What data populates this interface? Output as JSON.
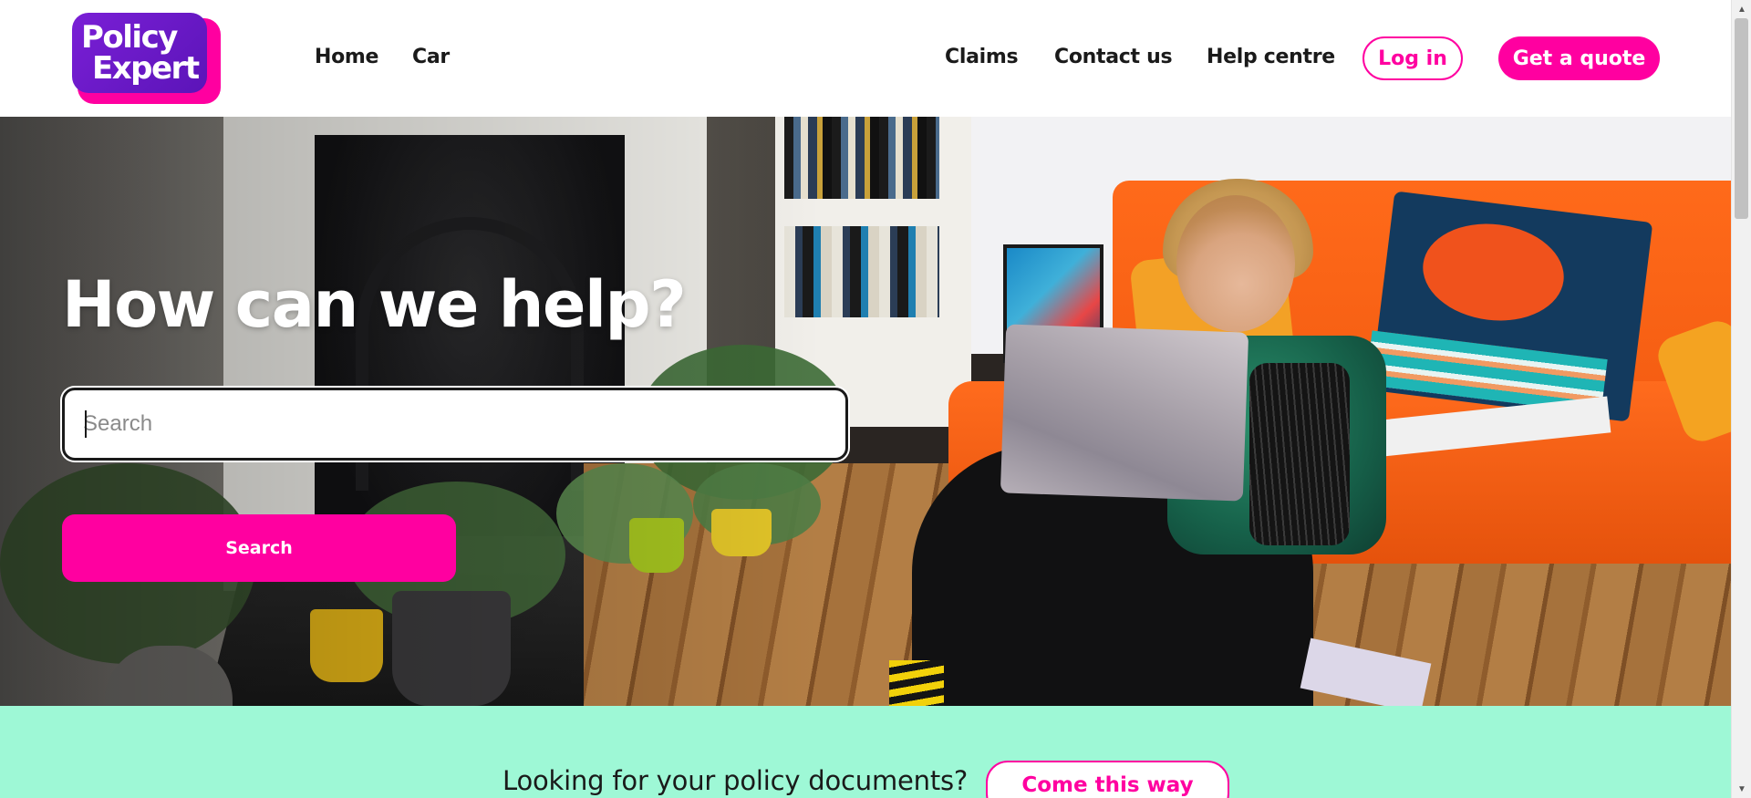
{
  "header": {
    "logo": {
      "line1": "Policy",
      "line2": "Expert"
    },
    "nav_left": [
      {
        "label": "Home"
      },
      {
        "label": "Car"
      }
    ],
    "nav_right": [
      {
        "label": "Claims"
      },
      {
        "label": "Contact us"
      },
      {
        "label": "Help centre"
      }
    ],
    "login_label": "Log in",
    "quote_label": "Get a quote"
  },
  "hero": {
    "title": "How can we help?",
    "search": {
      "placeholder": "Search",
      "value": ""
    },
    "search_button_label": "Search"
  },
  "banner": {
    "text": "Looking for your policy documents?",
    "button_label": "Come this way"
  },
  "colors": {
    "brand_pink": "#ff00a0",
    "brand_purple": "#6a17c6",
    "banner_mint": "#9ef8d6"
  },
  "icons": {
    "scroll_up": "chevron-up-icon",
    "scroll_down": "chevron-down-icon"
  }
}
